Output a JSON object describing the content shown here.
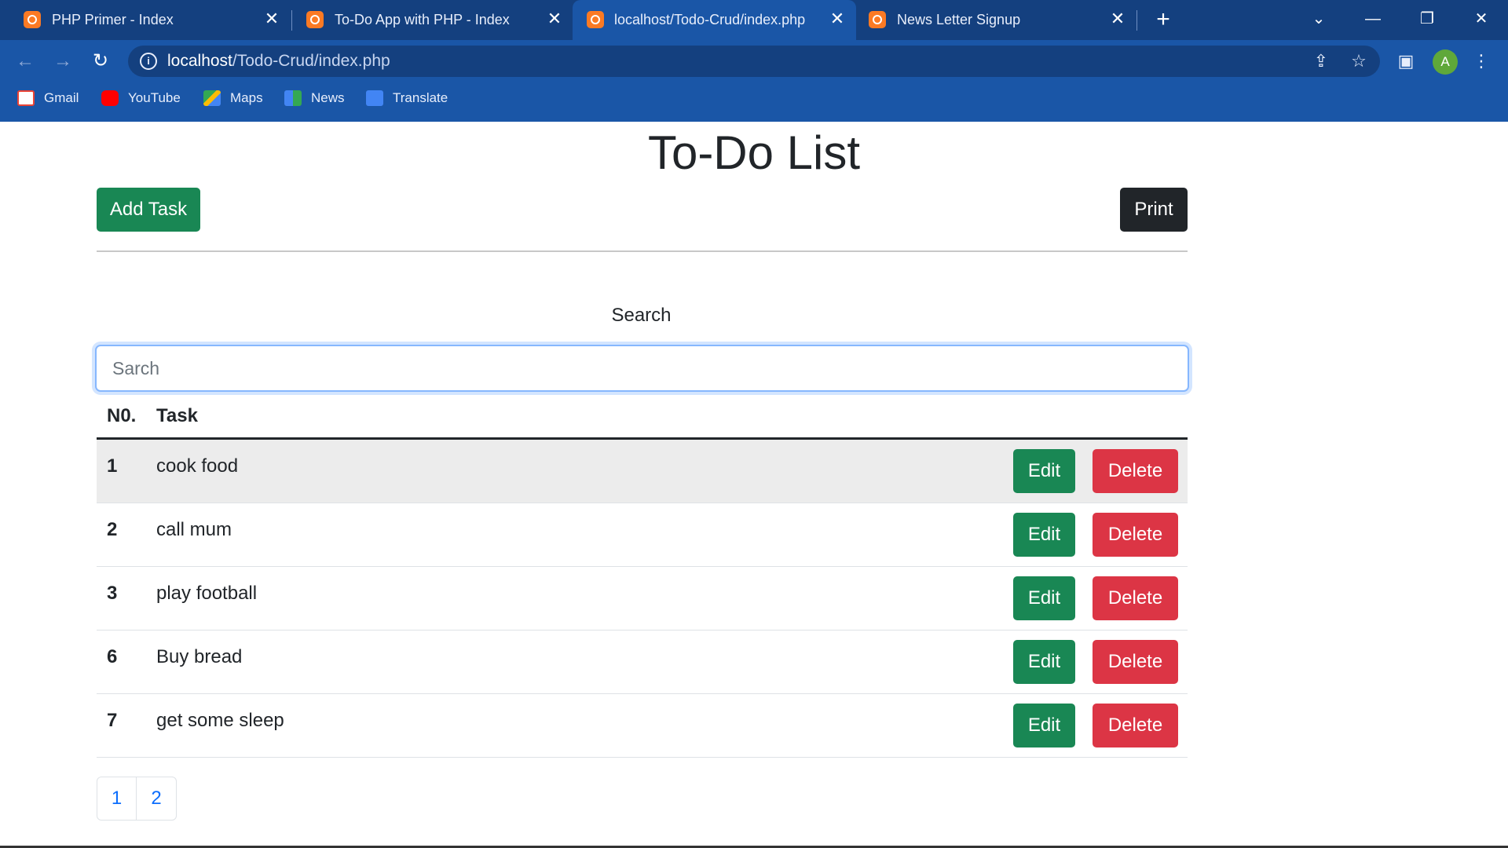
{
  "browser": {
    "tabs": [
      {
        "title": "PHP Primer - Index",
        "active": false
      },
      {
        "title": "To-Do App with PHP - Index",
        "active": false
      },
      {
        "title": "localhost/Todo-Crud/index.php",
        "active": true
      },
      {
        "title": "News Letter Signup",
        "active": false
      }
    ],
    "url_host": "localhost",
    "url_path": "/Todo-Crud/index.php",
    "profile_initial": "A",
    "bookmarks": [
      {
        "label": "Gmail",
        "icon": "gmail-icon"
      },
      {
        "label": "YouTube",
        "icon": "youtube-icon"
      },
      {
        "label": "Maps",
        "icon": "maps-icon"
      },
      {
        "label": "News",
        "icon": "news-icon"
      },
      {
        "label": "Translate",
        "icon": "translate-icon"
      }
    ]
  },
  "page": {
    "title": "To-Do List",
    "add_task_label": "Add Task",
    "print_label": "Print",
    "search_label": "Search",
    "search_placeholder": "Sarch",
    "search_value": "",
    "table": {
      "headers": [
        "N0.",
        "Task"
      ],
      "rows": [
        {
          "num": "1",
          "task": "cook food",
          "edit": "Edit",
          "delete": "Delete"
        },
        {
          "num": "2",
          "task": "call mum",
          "edit": "Edit",
          "delete": "Delete"
        },
        {
          "num": "3",
          "task": "play football",
          "edit": "Edit",
          "delete": "Delete"
        },
        {
          "num": "6",
          "task": "Buy bread",
          "edit": "Edit",
          "delete": "Delete"
        },
        {
          "num": "7",
          "task": "get some sleep",
          "edit": "Edit",
          "delete": "Delete"
        }
      ]
    },
    "pagination": [
      "1",
      "2"
    ]
  },
  "colors": {
    "success": "#198754",
    "danger": "#dc3545",
    "dark": "#212529",
    "link": "#0d6efd",
    "chrome": "#1a56a7"
  }
}
